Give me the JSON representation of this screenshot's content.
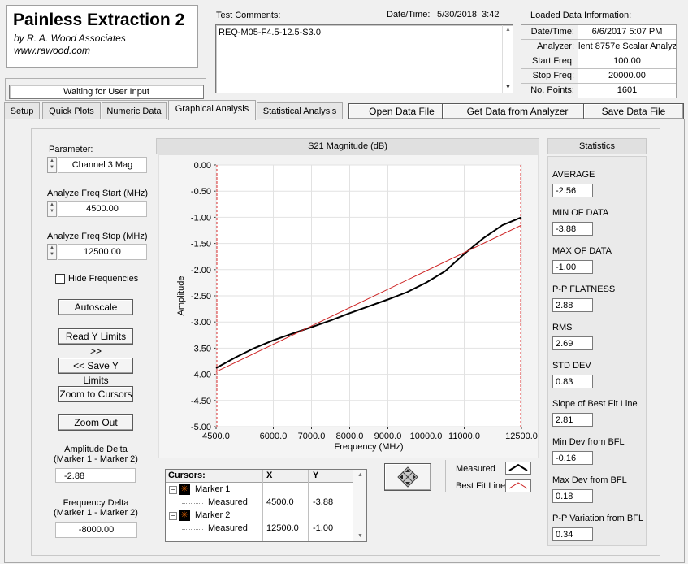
{
  "app": {
    "title": "Painless Extraction 2",
    "author": "by R. A. Wood Associates",
    "website": "www.rawood.com",
    "status": "Waiting for User Input"
  },
  "test": {
    "comments_label": "Test Comments:",
    "comments": "REQ-M05-F4.5-12.5-S3.0",
    "datetime_label": "Date/Time:",
    "datetime": "5/30/2018  3:42"
  },
  "loaded": {
    "title": "Loaded Data Information:",
    "rows": [
      {
        "k": "Date/Time:",
        "v": "6/6/2017 5:07 PM"
      },
      {
        "k": "Analyzer:",
        "v": "lent 8757e Scalar Analyz"
      },
      {
        "k": "Start Freq:",
        "v": "100.00"
      },
      {
        "k": "Stop Freq:",
        "v": "20000.00"
      },
      {
        "k": "No. Points:",
        "v": "1601"
      }
    ]
  },
  "tabs": [
    "Setup",
    "Quick Plots",
    "Numeric Data",
    "Graphical Analysis",
    "Statistical Analysis"
  ],
  "actions": {
    "open": "Open Data File",
    "get": "Get Data from Analyzer",
    "save": "Save Data File"
  },
  "controls": {
    "parameter_label": "Parameter:",
    "parameter": "Channel 3 Mag",
    "start_label": "Analyze Freq Start (MHz)",
    "start": "4500.00",
    "stop_label": "Analyze Freq Stop (MHz)",
    "stop": "12500.00",
    "hide_freq": "Hide Frequencies",
    "autoscale": "Autoscale",
    "read_y": "Read Y Limits >>",
    "save_y": "<< Save Y Limits",
    "zoom_cursors": "Zoom to Cursors",
    "zoom_out": "Zoom Out",
    "amp_delta_label": "Amplitude Delta\n(Marker 1 - Marker 2)",
    "amp_delta": "-2.88",
    "freq_delta_label": "Frequency Delta\n(Marker 1 - Marker 2)",
    "freq_delta": "-8000.00"
  },
  "stats": {
    "title": "Statistics",
    "items": [
      {
        "label": "AVERAGE",
        "value": "-2.56"
      },
      {
        "label": "MIN OF DATA",
        "value": "-3.88"
      },
      {
        "label": "MAX OF DATA",
        "value": "-1.00"
      },
      {
        "label": "P-P FLATNESS",
        "value": "2.88"
      },
      {
        "label": "RMS",
        "value": "2.69"
      },
      {
        "label": "STD DEV",
        "value": "0.83"
      },
      {
        "label": "Slope of Best Fit Line",
        "value": "2.81"
      },
      {
        "label": "Min Dev from BFL",
        "value": "-0.16"
      },
      {
        "label": "Max Dev from BFL",
        "value": "0.18"
      },
      {
        "label": "P-P Variation from BFL",
        "value": "0.34"
      }
    ]
  },
  "cursors": {
    "headers": [
      "Cursors:",
      "X",
      "Y"
    ],
    "rows": [
      {
        "name": "Marker 1",
        "sub": "Measured",
        "x": "4500.0",
        "y": "-3.88"
      },
      {
        "name": "Marker 2",
        "sub": "Measured",
        "x": "12500.0",
        "y": "-1.00"
      }
    ]
  },
  "legend": {
    "measured": "Measured",
    "fit": "Best Fit Line",
    "measured_color": "#000000",
    "fit_color": "#cc2020"
  },
  "chart_data": {
    "type": "line",
    "title": "S21 Magnitude (dB)",
    "xlabel": "Frequency (MHz)",
    "ylabel": "Amplitude",
    "xlim": [
      4500,
      12500
    ],
    "ylim": [
      -5.0,
      0.0
    ],
    "x_ticks": [
      "4500.0",
      "6000.0",
      "7000.0",
      "8000.0",
      "9000.0",
      "10000.0",
      "11000.0",
      "12500.0"
    ],
    "x_tick_values": [
      4500,
      6000,
      7000,
      8000,
      9000,
      10000,
      11000,
      12500
    ],
    "y_ticks": [
      "0.00",
      "-0.50",
      "-1.00",
      "-1.50",
      "-2.00",
      "-2.50",
      "-3.00",
      "-3.50",
      "-4.00",
      "-4.50",
      "-5.00"
    ],
    "y_tick_values": [
      0,
      -0.5,
      -1.0,
      -1.5,
      -2.0,
      -2.5,
      -3.0,
      -3.5,
      -4.0,
      -4.5,
      -5.0
    ],
    "grid": true,
    "series": [
      {
        "name": "Measured",
        "x": [
          4500,
          5000,
          5500,
          6000,
          6500,
          7000,
          7500,
          8000,
          8500,
          9000,
          9500,
          10000,
          10500,
          11000,
          11500,
          12000,
          12500
        ],
        "y": [
          -3.88,
          -3.68,
          -3.5,
          -3.35,
          -3.22,
          -3.1,
          -2.97,
          -2.83,
          -2.7,
          -2.57,
          -2.43,
          -2.25,
          -2.03,
          -1.7,
          -1.4,
          -1.15,
          -1.0
        ]
      },
      {
        "name": "Best Fit Line",
        "x": [
          4500,
          12500
        ],
        "y": [
          -3.95,
          -1.15
        ]
      }
    ]
  }
}
